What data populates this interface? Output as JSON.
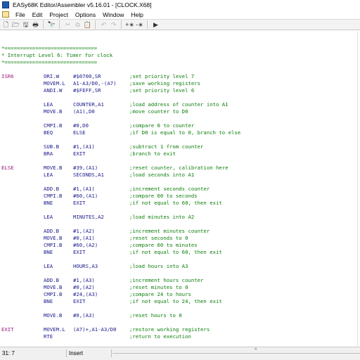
{
  "window": {
    "title": "EASy68K Editor/Assembler v5.16.01 - [CLOCK.X68]"
  },
  "menu": [
    "File",
    "Edit",
    "Project",
    "Options",
    "Window",
    "Help"
  ],
  "toolbar": [
    {
      "name": "new-file-icon",
      "glyph": "🗋",
      "enabled": true
    },
    {
      "name": "open-file-icon",
      "glyph": "🗁",
      "enabled": true
    },
    {
      "name": "save-icon",
      "glyph": "🖫",
      "enabled": true
    },
    {
      "name": "print-icon",
      "glyph": "🖶",
      "enabled": true
    },
    {
      "sep": true
    },
    {
      "name": "find-icon",
      "glyph": "🔭",
      "enabled": true
    },
    {
      "sep": true
    },
    {
      "name": "cut-icon",
      "glyph": "✂",
      "enabled": false
    },
    {
      "name": "copy-icon",
      "glyph": "⧉",
      "enabled": false
    },
    {
      "name": "paste-icon",
      "glyph": "📋",
      "enabled": false
    },
    {
      "sep": true
    },
    {
      "name": "undo-icon",
      "glyph": "↶",
      "enabled": false
    },
    {
      "name": "redo-icon",
      "glyph": "↷",
      "enabled": false
    },
    {
      "sep": true
    },
    {
      "name": "comment-add-icon",
      "glyph": "+∗",
      "enabled": true
    },
    {
      "name": "comment-remove-icon",
      "glyph": "-∗",
      "enabled": true
    },
    {
      "sep": true
    },
    {
      "name": "assemble-run-icon",
      "glyph": "▶",
      "enabled": true
    }
  ],
  "code": [
    {
      "row": 0,
      "comment": "*=============================="
    },
    {
      "row": 1,
      "comment": "* Interrupt Level 6: Timer for clock"
    },
    {
      "row": 2,
      "comment": "*=============================="
    },
    {
      "row": 4,
      "label": "ISR6",
      "op": "ORI.W",
      "args": "#$0700,SR",
      "comment": ";set priority level 7"
    },
    {
      "row": 5,
      "op": "MOVEM.L",
      "args": "A1-A3/D0,-(A7)",
      "comment": ";save working registers"
    },
    {
      "row": 6,
      "op": "ANDI.W",
      "args": "#$FEFF,SR",
      "comment": ";set priority level 6"
    },
    {
      "row": 8,
      "op": "LEA",
      "args": "COUNTER,A1",
      "comment": ";load address of counter into A1"
    },
    {
      "row": 9,
      "op": "MOVE.B",
      "args": "(A1),D0",
      "comment": ";move counter to D0"
    },
    {
      "row": 11,
      "op": "CMPI.B",
      "args": "#0,D0",
      "comment": ";compare 0 to counter"
    },
    {
      "row": 12,
      "op": "BEQ",
      "args": "ELSE",
      "comment": ";if D0 is equal to 0, branch to else"
    },
    {
      "row": 14,
      "op": "SUB.B",
      "args": "#1,(A1)",
      "comment": ";subtract 1 from counter"
    },
    {
      "row": 15,
      "op": "BRA",
      "args": "EXIT",
      "comment": ";branch to exit"
    },
    {
      "row": 17,
      "label": "ELSE",
      "op": "MOVE.B",
      "args": "#39,(A1)",
      "comment": ";reset counter, calibration here"
    },
    {
      "row": 18,
      "op": "LEA",
      "args": "SECONDS,A1",
      "comment": ";load seconds into A1"
    },
    {
      "row": 20,
      "op": "ADD.B",
      "args": "#1,(A1)",
      "comment": ";increment seconds counter"
    },
    {
      "row": 21,
      "op": "CMPI.B",
      "args": "#60,(A1)",
      "comment": ";compare 60 to seconds"
    },
    {
      "row": 22,
      "op": "BNE",
      "args": "EXIT",
      "comment": ";if not equal to 60, then exit"
    },
    {
      "row": 24,
      "op": "LEA",
      "args": "MINUTES,A2",
      "comment": ";load minutes into A2"
    },
    {
      "row": 26,
      "op": "ADD.B",
      "args": "#1,(A2)",
      "comment": ";increment minutes counter"
    },
    {
      "row": 27,
      "op": "MOVE.B",
      "args": "#0,(A1)",
      "comment": ";reset seconds to 0"
    },
    {
      "row": 28,
      "op": "CMPI.B",
      "args": "#60,(A2)",
      "comment": ";compare 60 to minutes"
    },
    {
      "row": 29,
      "op": "BNE",
      "args": "EXIT",
      "comment": ";if not equal to 60, then exit"
    },
    {
      "row": 31,
      "op": "LEA",
      "args": "HOURS,A3",
      "comment": ";load hours into A3"
    },
    {
      "row": 33,
      "op": "ADD.B",
      "args": "#1,(A3)",
      "comment": ";increment hours counter"
    },
    {
      "row": 34,
      "op": "MOVE.B",
      "args": "#0,(A2)",
      "comment": ";reset minutes to 0"
    },
    {
      "row": 35,
      "op": "CMPI.B",
      "args": "#24,(A3)",
      "comment": ";compare 24 to hours"
    },
    {
      "row": 36,
      "op": "BNE",
      "args": "EXIT",
      "comment": ";if not equal to 24, then exit"
    },
    {
      "row": 38,
      "op": "MOVE.B",
      "args": "#0,(A3)",
      "comment": ";reset hours to 0"
    },
    {
      "row": 40,
      "label": "EXIT",
      "op": "MOVEM.L",
      "args": "(A7)+,A1-A3/D0",
      "comment": ";restore working registers"
    },
    {
      "row": 41,
      "op": "RTE",
      "args": "",
      "comment": ";return to execution"
    }
  ],
  "status": {
    "position": "31: 7",
    "mode": "Insert"
  },
  "colors": {
    "comment": "#0a7e0a",
    "label": "#9b1d7d",
    "code": "#1a1a8c"
  }
}
